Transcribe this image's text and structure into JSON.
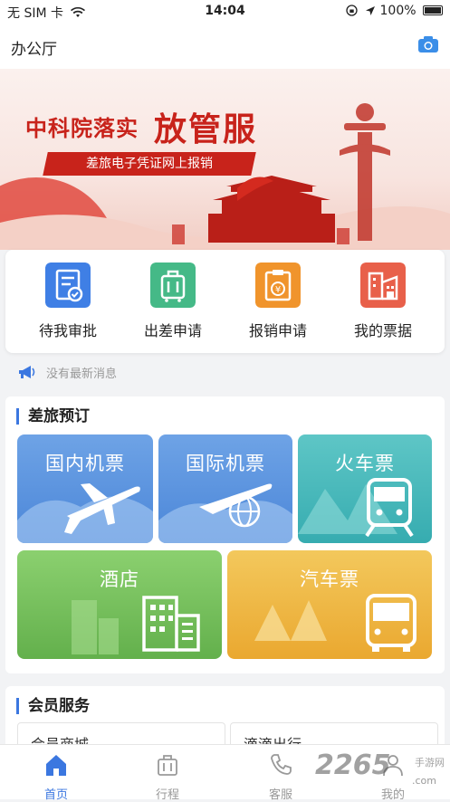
{
  "status_bar": {
    "carrier": "无 SIM 卡",
    "time": "14:04",
    "battery": "100%"
  },
  "nav": {
    "title": "办公厅"
  },
  "banner": {
    "headline_left": "中科院落实",
    "headline_right": "放管服",
    "ribbon": "差旅电子凭证网上报销"
  },
  "quick_actions": [
    {
      "label": "待我审批",
      "icon": "approval-icon",
      "color": "#3f7fe5"
    },
    {
      "label": "出差申请",
      "icon": "luggage-icon",
      "color": "#45b987"
    },
    {
      "label": "报销申请",
      "icon": "reimburse-icon",
      "color": "#f0942c"
    },
    {
      "label": "我的票据",
      "icon": "receipt-building-icon",
      "color": "#e8604a"
    }
  ],
  "notice": {
    "text": "没有最新消息",
    "icon": "megaphone-icon"
  },
  "travel": {
    "title": "差旅预订",
    "tiles": [
      {
        "label": "国内机票",
        "icon": "plane-icon",
        "color": "#5b95df"
      },
      {
        "label": "国际机票",
        "icon": "globe-plane-icon",
        "color": "#5b95df"
      },
      {
        "label": "火车票",
        "icon": "train-icon",
        "color": "#3fb5b8"
      },
      {
        "label": "酒店",
        "icon": "hotel-icon",
        "color": "#74c05f"
      },
      {
        "label": "汽车票",
        "icon": "bus-icon",
        "color": "#efb83e"
      }
    ]
  },
  "member": {
    "title": "会员服务",
    "items": [
      "会员商城",
      "滴滴出行"
    ]
  },
  "tabs": [
    {
      "label": "首页",
      "icon": "home-icon"
    },
    {
      "label": "行程",
      "icon": "suitcase-icon"
    },
    {
      "label": "客服",
      "icon": "phone-icon"
    },
    {
      "label": "我的",
      "icon": "user-icon"
    }
  ],
  "watermark": {
    "brand": "2265",
    "tag": "手游网",
    "domain": ".com"
  }
}
